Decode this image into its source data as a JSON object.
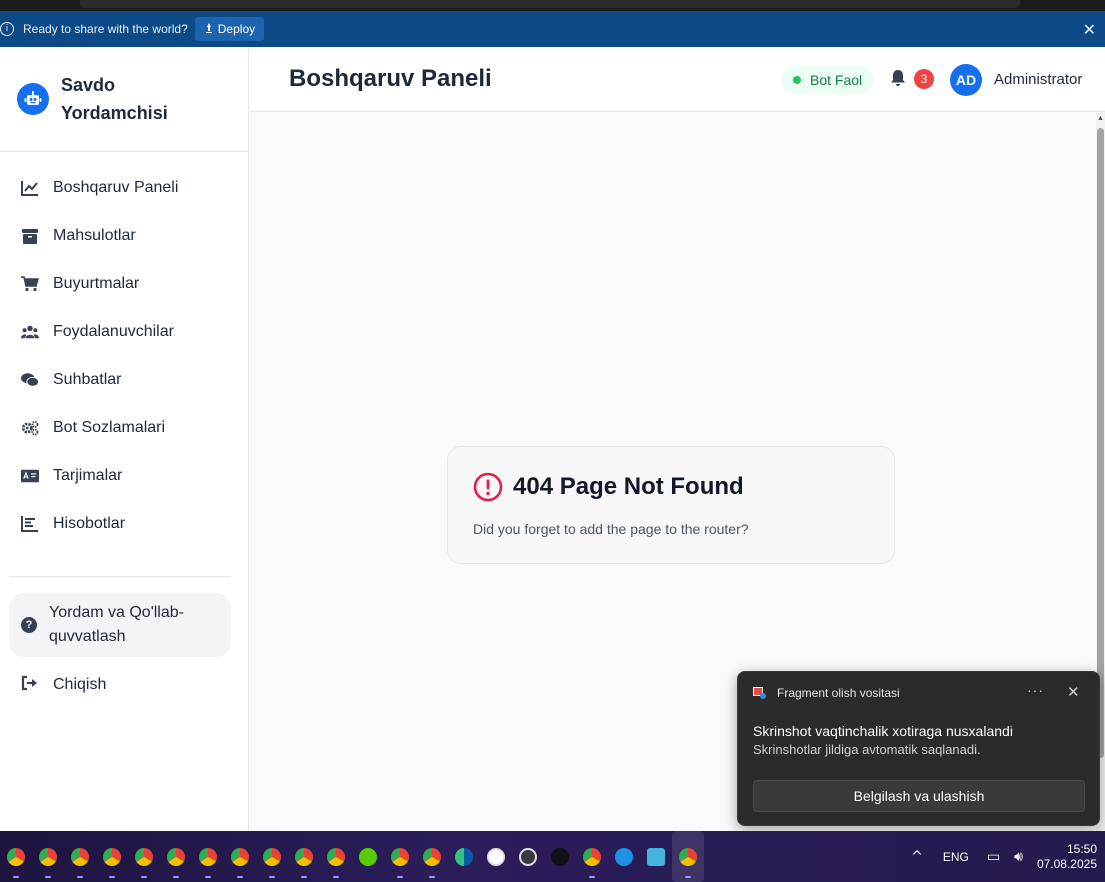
{
  "banner": {
    "message": "Ready to share with the world?",
    "deploy_label": "Deploy",
    "close": "✕"
  },
  "sidebar": {
    "brand_line1": "Savdo",
    "brand_line2": "Yordamchisi",
    "items": [
      {
        "label": "Boshqaruv Paneli",
        "icon": "chart-line-icon"
      },
      {
        "label": "Mahsulotlar",
        "icon": "box-icon"
      },
      {
        "label": "Buyurtmalar",
        "icon": "cart-icon"
      },
      {
        "label": "Foydalanuvchilar",
        "icon": "users-icon"
      },
      {
        "label": "Suhbatlar",
        "icon": "chat-icon"
      },
      {
        "label": "Bot Sozlamalari",
        "icon": "gears-icon"
      },
      {
        "label": "Tarjimalar",
        "icon": "translate-icon"
      },
      {
        "label": "Hisobotlar",
        "icon": "bar-chart-icon"
      }
    ],
    "help_line1": "Yordam va Qo'llab-",
    "help_line2": "quvvatlash",
    "logout_label": "Chiqish"
  },
  "header": {
    "title": "Boshqaruv Paneli",
    "status": "Bot Faol",
    "notification_count": "3",
    "avatar_initials": "AD",
    "username": "Administrator"
  },
  "error": {
    "heading": "404 Page Not Found",
    "message": "Did you forget to add the page to the router?"
  },
  "toast": {
    "app_name": "Fragment olish vositasi",
    "more": "···",
    "close": "✕",
    "title": "Skrinshot vaqtinchalik xotiraga nusxalandi",
    "body": "Skrinshotlar jildiga avtomatik saqlanadi.",
    "action": "Belgilash va ulashish"
  },
  "taskbar": {
    "language": "ENG",
    "time": "15:50",
    "date": "07.08.2025"
  },
  "colors": {
    "accent": "#1570ef",
    "banner": "#0b4a86",
    "status_green": "#22c55e",
    "badge_red": "#ef4444",
    "error_red": "#e11d48"
  }
}
